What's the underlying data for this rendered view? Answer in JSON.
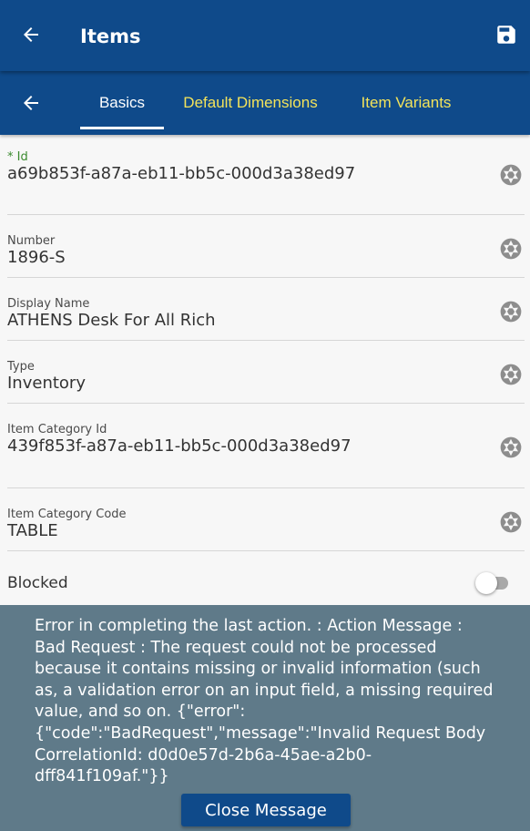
{
  "header": {
    "title": "Items",
    "back_icon": "arrow-left-icon",
    "save_icon": "save-floppy-icon",
    "background": "#0f4a8a"
  },
  "tabs": {
    "back_icon": "arrow-left-icon",
    "items": [
      {
        "label": "Basics",
        "active": true
      },
      {
        "label": "Default Dimensions",
        "active": false
      },
      {
        "label": "Item Variants",
        "active": false
      }
    ],
    "active_color": "#ffffff",
    "inactive_color": "#f3e35a"
  },
  "fields": [
    {
      "label": "* Id",
      "value": "a69b853f-a87a-eb11-bb5c-000d3a38ed97",
      "required": true,
      "icon": "lens-icon"
    },
    {
      "label": "Number",
      "value": "1896-S",
      "icon": "lens-icon"
    },
    {
      "label": "Display Name",
      "value": "ATHENS Desk For All Rich",
      "icon": "lens-icon"
    },
    {
      "label": "Type",
      "value": "Inventory",
      "icon": "lens-icon"
    },
    {
      "label": "Item Category Id",
      "value": "439f853f-a87a-eb11-bb5c-000d3a38ed97",
      "icon": "lens-icon"
    },
    {
      "label": "Item Category Code",
      "value": "TABLE",
      "icon": "lens-icon"
    }
  ],
  "blocked": {
    "label": "Blocked",
    "checked": false
  },
  "error": {
    "message": "Error in completing the last action.  : Action Message : Bad Request : The request could not be processed because it contains missing or invalid information (such as, a validation error on an input field, a missing required value, and so on. {\"error\":{\"code\":\"BadRequest\",\"message\":\"Invalid Request Body  CorrelationId:  d0d0e57d-2b6a-45ae-a2b0-dff841f109af.\"}}",
    "close_label": "Close Message",
    "background": "#5f7a89"
  }
}
